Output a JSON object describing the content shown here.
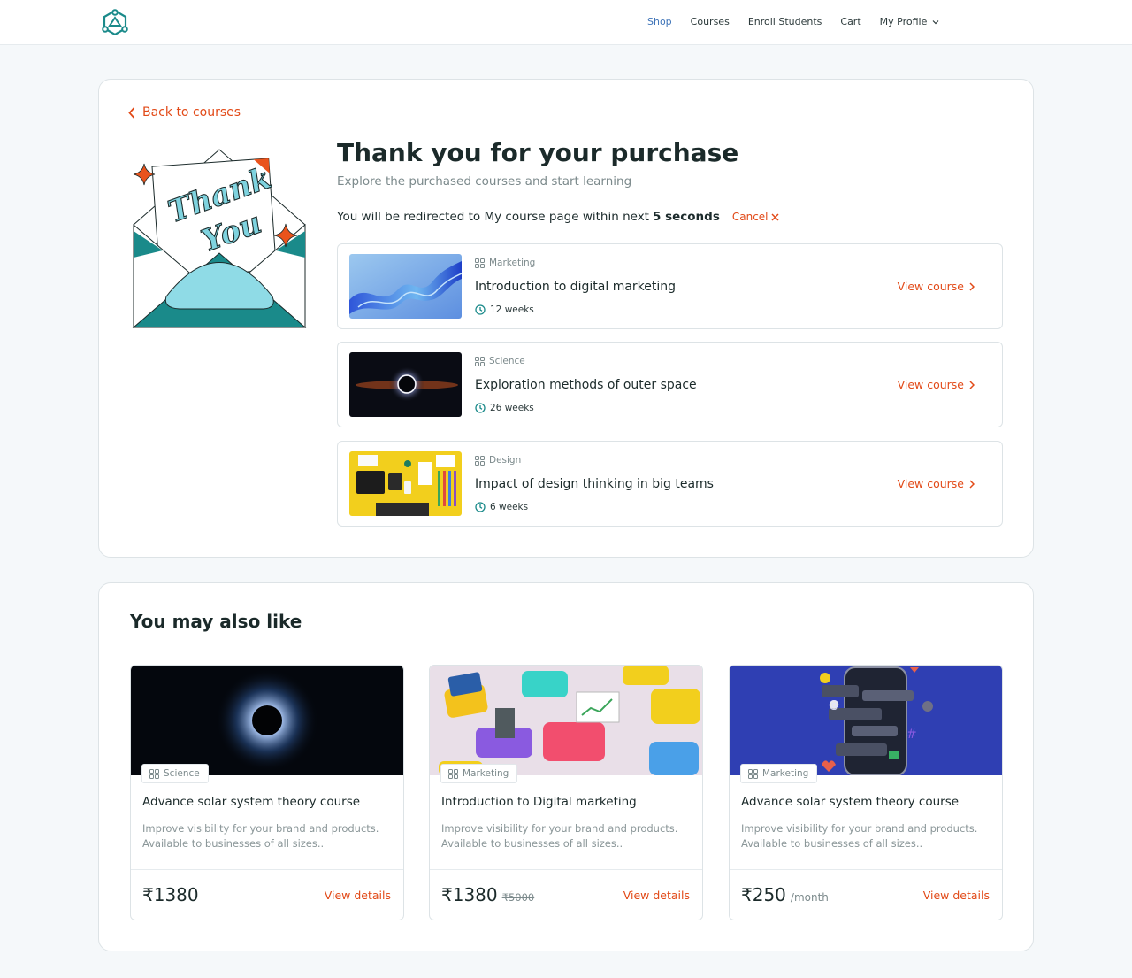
{
  "nav": {
    "items": [
      "Shop",
      "Courses",
      "Enroll Students",
      "Cart"
    ],
    "active": "Shop",
    "profile_label": "My Profile"
  },
  "purchase": {
    "back_label": "Back to courses",
    "title": "Thank you for your purchase",
    "subtitle": "Explore the purchased courses and start learning",
    "redirect_text": "You will be redirected to My course page within next",
    "redirect_seconds": "5 seconds",
    "cancel_label": "Cancel",
    "illustration_text": [
      "Thank",
      "You"
    ],
    "items": [
      {
        "category": "Marketing",
        "name": "Introduction to digital marketing",
        "duration": "12 weeks",
        "view_label": "View course"
      },
      {
        "category": "Science",
        "name": "Exploration methods of outer space",
        "duration": "26 weeks",
        "view_label": "View course"
      },
      {
        "category": "Design",
        "name": "Impact of design thinking in big teams",
        "duration": "6 weeks",
        "view_label": "View course"
      }
    ]
  },
  "recommended": {
    "title": "You may also like",
    "cards": [
      {
        "category": "Science",
        "name": "Advance solar system theory course",
        "desc_line1": "Improve visibility for your brand and products.",
        "desc_line2": "Available to businesses of all sizes..",
        "price": "₹1380",
        "old_price": "",
        "period": "",
        "view_label": "View details"
      },
      {
        "category": "Marketing",
        "name": "Introduction to Digital marketing",
        "desc_line1": "Improve visibility for your brand and products.",
        "desc_line2": "Available to businesses of all sizes..",
        "price": "₹1380",
        "old_price": "₹5000",
        "period": "",
        "view_label": "View details"
      },
      {
        "category": "Marketing",
        "name": "Advance solar system theory course",
        "desc_line1": "Improve visibility for your brand and products.",
        "desc_line2": "Available to businesses of all sizes..",
        "price": "₹250",
        "old_price": "",
        "period": "/month",
        "view_label": "View details"
      }
    ]
  },
  "colors": {
    "accent": "#e24a18",
    "brand": "#1a8a8a",
    "nav_active": "#3f74b8"
  }
}
